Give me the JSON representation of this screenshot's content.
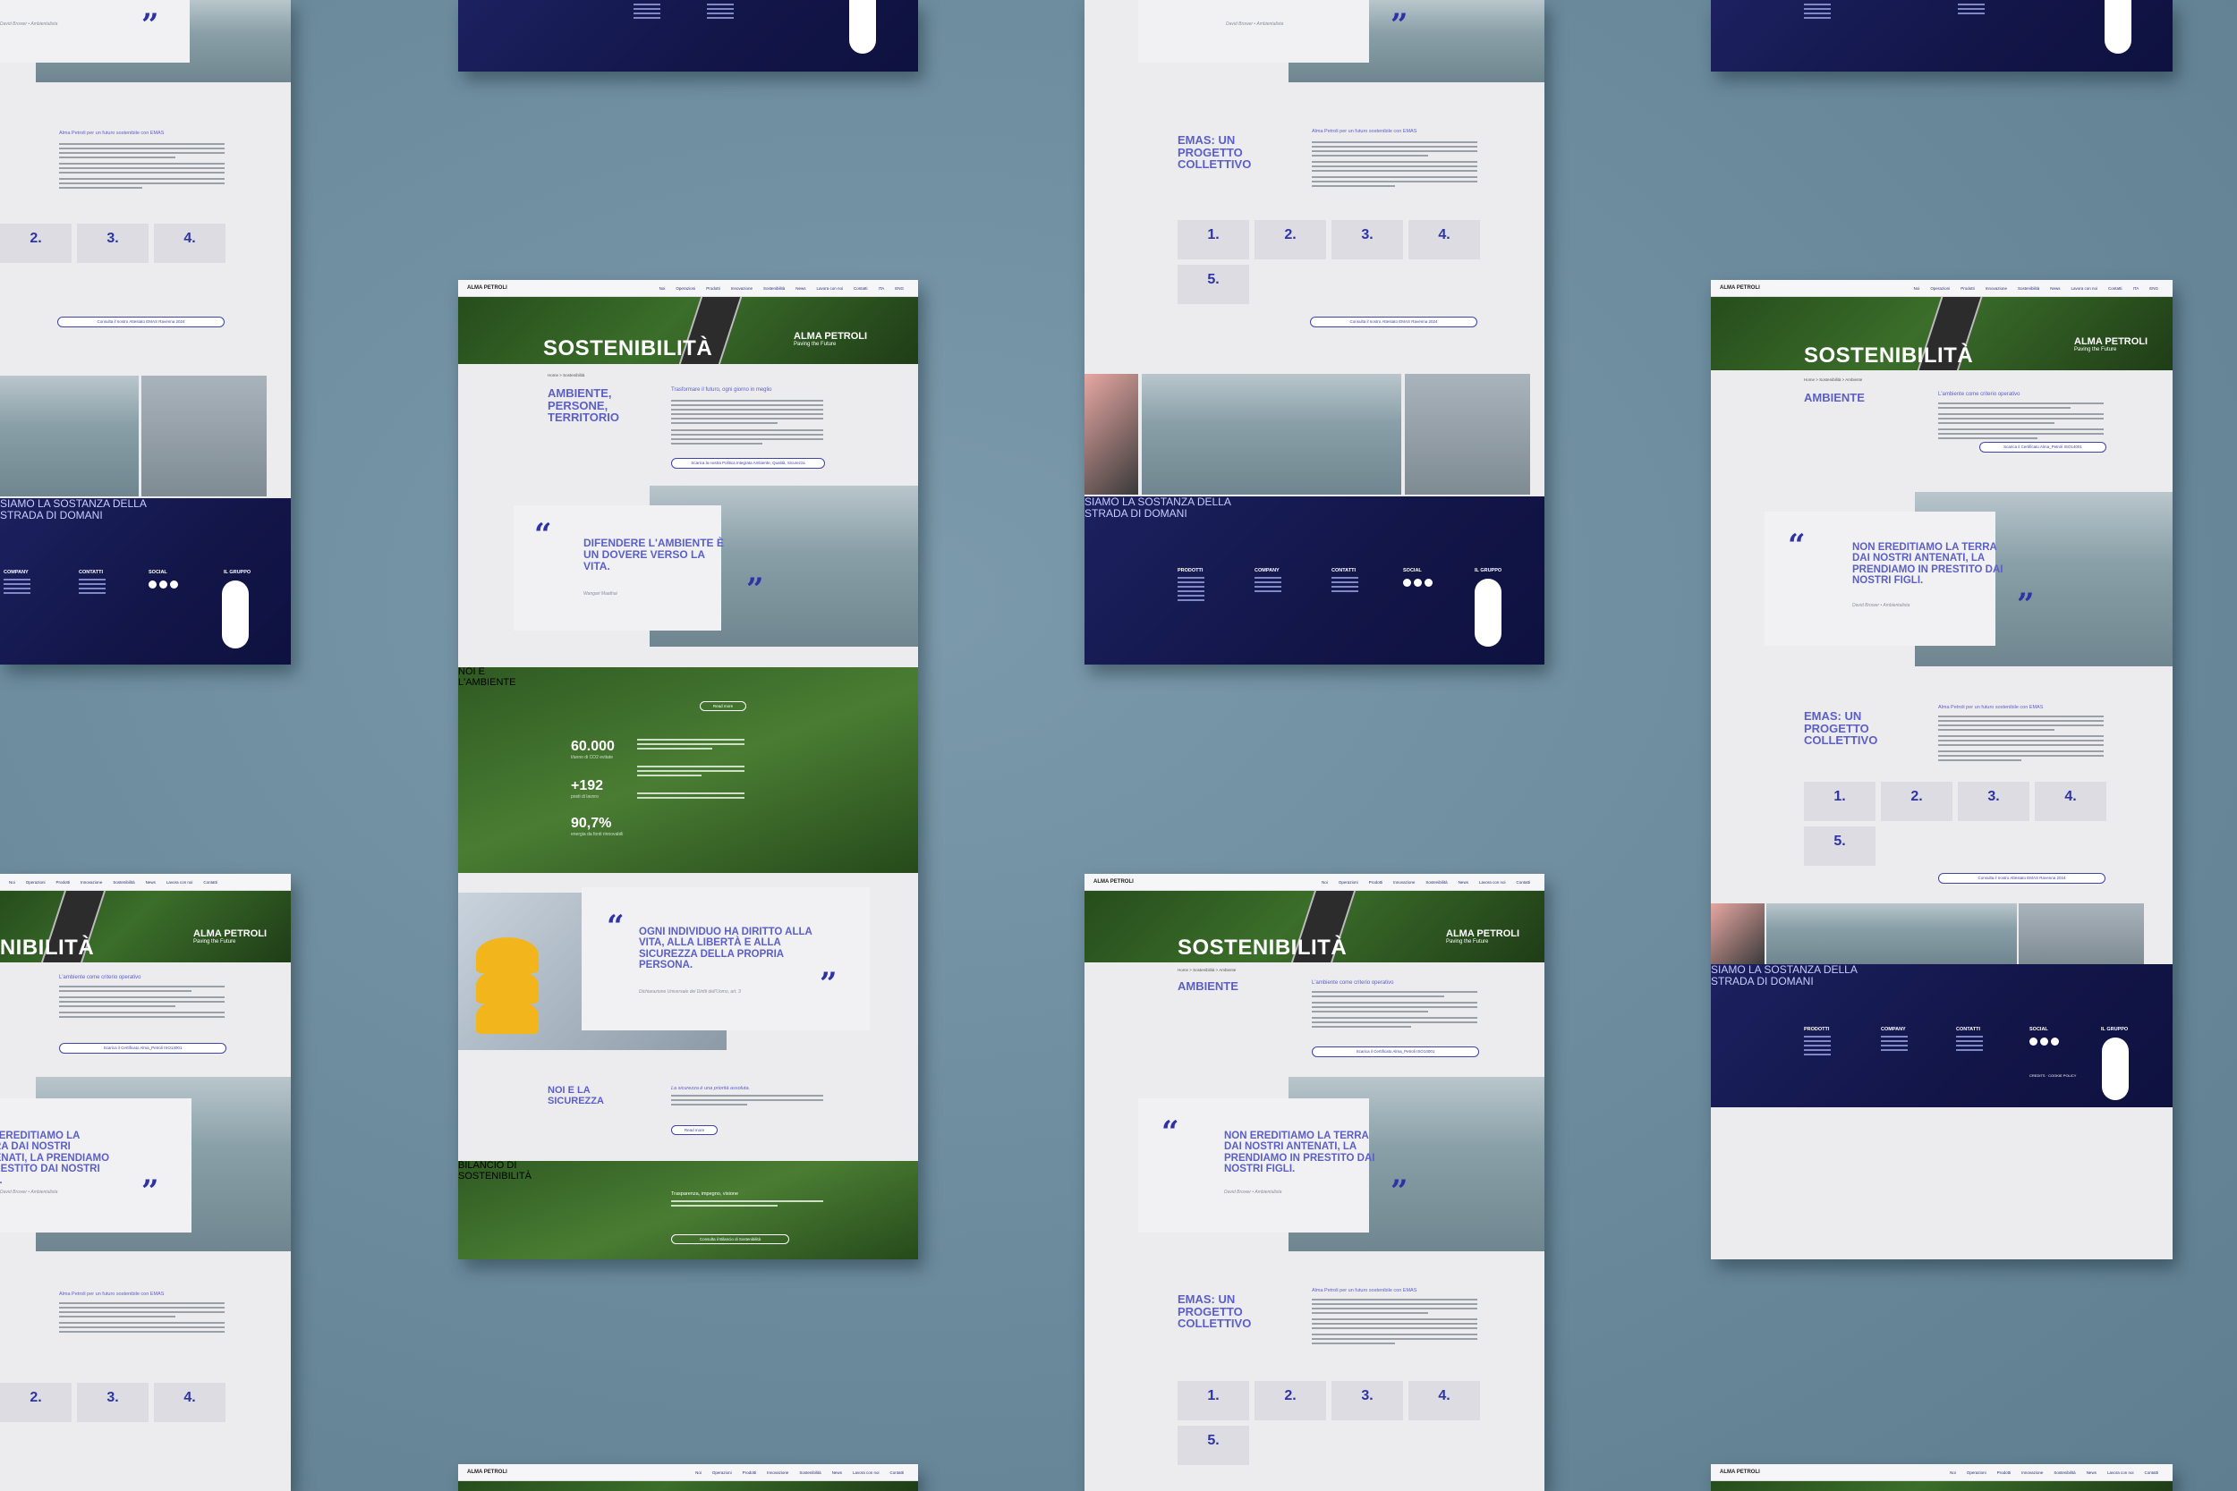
{
  "brand": {
    "name": "ALMA PETROLI",
    "tagline": "Paving the Future"
  },
  "nav": {
    "items": [
      "Noi",
      "Operazioni",
      "Prodotti",
      "Innovazione",
      "Sostenibilità",
      "News",
      "Lavora con noi",
      "Contatti"
    ],
    "lang": [
      "ITA",
      "ENG"
    ]
  },
  "colors": {
    "accent": "#5b5fc6",
    "navy": "#1c2160",
    "green": "#3b6e2a",
    "background": "#6f8fa0"
  },
  "sostenibilita_page": {
    "hero_title": "SOSTENIBILITÀ",
    "breadcrumb": "Home > Sostenibilità",
    "section_title": "AMBIENTE, PERSONE, TERRITORIO",
    "intro_heading": "Trasformare il futuro, ogni giorno in meglio",
    "intro_button": "Scarica la nostra Politica Integrata Ambiente, Qualità, Sicurezza",
    "quote1": "DIFENDERE L'AMBIENTE È UN DOVERE VERSO LA VITA.",
    "quote1_author": "Wangari Maathai",
    "env_title": "NOI E L'AMBIENTE",
    "env_button": "Read more",
    "stats": [
      {
        "value": "60.000",
        "label": "t/anno di CO2 evitate"
      },
      {
        "value": "+192",
        "label": "posti di lavoro"
      },
      {
        "value": "90,7%",
        "label": "energia da fonti rinnovabili"
      }
    ],
    "quote2": "OGNI INDIVIDUO HA DIRITTO ALLA VITA, ALLA LIBERTÀ E ALLA SICUREZZA DELLA PROPRIA PERSONA.",
    "quote2_author": "Dichiarazione Universale dei Diritti dell'Uomo, art. 3",
    "safety_title": "NOI E LA SICUREZZA",
    "safety_heading": "La sicurezza è una priorità assoluta.",
    "safety_button": "Read more",
    "report_title": "BILANCIO DI SOSTENIBILITÀ",
    "report_heading": "Trasparenza, impegno, visione",
    "report_button": "Consulta il Bilancio di Sostenibilità"
  },
  "ambiente_page": {
    "hero_title": "SOSTENIBILITÀ",
    "breadcrumb": "Home > Sostenibilità > Ambiente",
    "section_title": "AMBIENTE",
    "intro_heading": "L'ambiente come criterio operativo",
    "download_button": "Scarica il Certificato Alma_Petroli ISO14001",
    "quote": "NON EREDITIAMO LA TERRA DAI NOSTRI ANTENATI, LA PRENDIAMO IN PRESTITO DAI NOSTRI FIGLI.",
    "quote_author": "David Brower • Ambientalista",
    "emas_title": "EMAS: UN PROGETTO COLLETTIVO",
    "emas_heading": "Alma Petroli per un futuro sostenibile con EMAS",
    "emas_steps": [
      "1.",
      "2.",
      "3.",
      "4.",
      "5."
    ],
    "emas_button": "Consulta il nostro Attestato EMAS Ravenna 2024",
    "closing": "SIAMO LA SOSTANZA DELLA STRADA DI DOMANI"
  },
  "footer": {
    "columns": [
      "PRODOTTI",
      "COMPANY",
      "CONTATTI",
      "SOCIAL",
      "IL GRUPPO"
    ],
    "credits": "CREDITS · COOKIE POLICY"
  }
}
